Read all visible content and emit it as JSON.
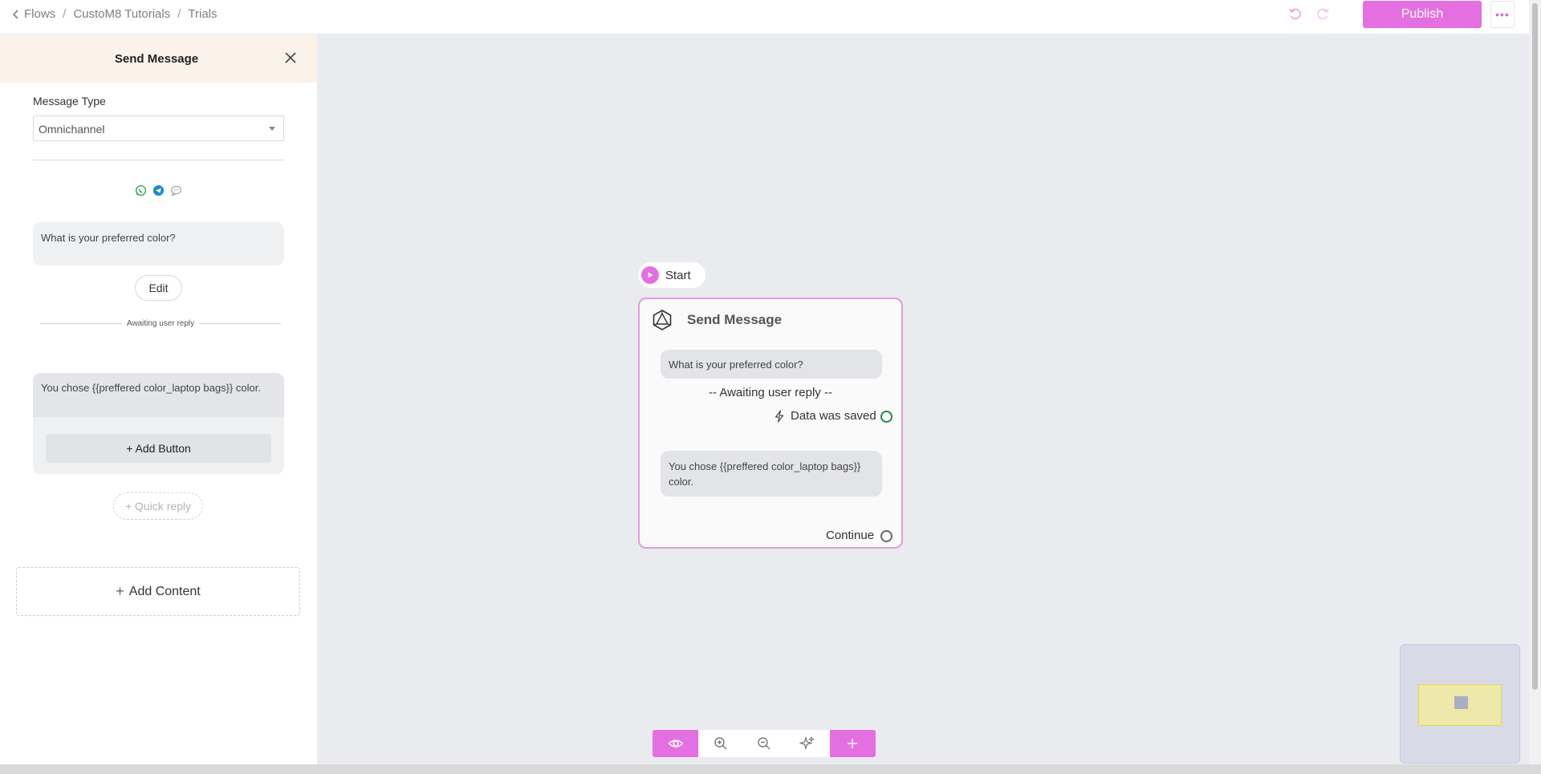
{
  "breadcrumb": {
    "items": [
      "Flows",
      "CustoM8 Tutorials",
      "Trials"
    ],
    "sep": "/"
  },
  "header": {
    "publish_label": "Publish",
    "more_label": "•••"
  },
  "panel": {
    "title": "Send Message",
    "message_type_label": "Message Type",
    "message_type_value": "Omnichannel",
    "channels": [
      "whatsapp-icon",
      "telegram-icon",
      "chat-icon"
    ],
    "question_text": "What is your preferred color?",
    "edit_label": "Edit",
    "awaiting_label": "Awaiting user reply",
    "reply_text": "You chose {{preffered color_laptop bags}} color.",
    "add_button_label": "+ Add Button",
    "quick_reply_label": "+ Quick reply",
    "add_content_label": "Add Content"
  },
  "node": {
    "start_label": "Start",
    "title": "Send Message",
    "question_text": "What is your preferred color?",
    "awaiting_label": "-- Awaiting user reply --",
    "saved_label": "Data was saved",
    "reply_text": "You chose {{preffered color_laptop bags}} color.",
    "continue_label": "Continue"
  },
  "colors": {
    "accent": "#e46fe0",
    "canvas": "#e9ebef",
    "panel_header": "#fbf3ea",
    "saved_dot": "#1d8a3a"
  }
}
